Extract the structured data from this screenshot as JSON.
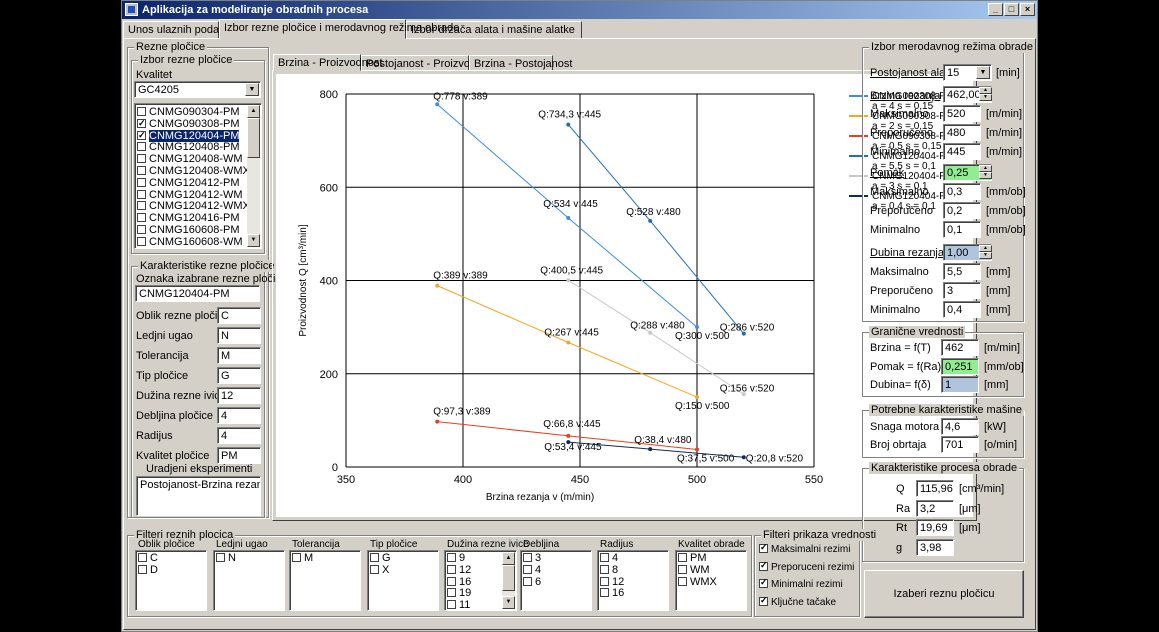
{
  "window": {
    "title": "Aplikacija za modeliranje obradnih procesa"
  },
  "main_tabs": [
    {
      "label": "Unos ulaznih podataka"
    },
    {
      "label": "Izbor rezne pločice i merodavnog režima obrade"
    },
    {
      "label": "Izbor držača alata i mašine alatke"
    }
  ],
  "rezne_plocice": {
    "group_label": "Rezne pločice",
    "izbor_label": "Izbor rezne pločice",
    "kvalitet_label": "Kvalitet",
    "kvalitet_value": "GC4205",
    "items": [
      {
        "label": "CNMG090304-PM",
        "checked": false,
        "selected": false
      },
      {
        "label": "CNMG090308-PM",
        "checked": true,
        "selected": false
      },
      {
        "label": "CNMG120404-PM",
        "checked": true,
        "selected": true
      },
      {
        "label": "CNMG120408-PM",
        "checked": false,
        "selected": false
      },
      {
        "label": "CNMG120408-WM",
        "checked": false,
        "selected": false
      },
      {
        "label": "CNMG120408-WMX",
        "checked": false,
        "selected": false
      },
      {
        "label": "CNMG120412-PM",
        "checked": false,
        "selected": false
      },
      {
        "label": "CNMG120412-WM",
        "checked": false,
        "selected": false
      },
      {
        "label": "CNMG120412-WMX",
        "checked": false,
        "selected": false
      },
      {
        "label": "CNMG120416-PM",
        "checked": false,
        "selected": false
      },
      {
        "label": "CNMG160608-PM",
        "checked": false,
        "selected": false
      },
      {
        "label": "CNMG160608-WM",
        "checked": false,
        "selected": false
      }
    ]
  },
  "karakteristike": {
    "group_label": "Karakteristike rezne pločice",
    "oznaka_label": "Oznaka izabrane rezne pločice",
    "oznaka_value": "CNMG120404-PM",
    "fields": [
      {
        "label": "Oblik rezne pločice",
        "value": "C"
      },
      {
        "label": "Ledjni ugao",
        "value": "N"
      },
      {
        "label": "Tolerancija",
        "value": "M"
      },
      {
        "label": "Tip pločice",
        "value": "G"
      },
      {
        "label": "Dužina rezne ivice",
        "value": "12"
      },
      {
        "label": "Debljina pločice",
        "value": "4"
      },
      {
        "label": "Radijus",
        "value": "4"
      },
      {
        "label": "Kvalitet  pločice",
        "value": "PM"
      }
    ],
    "eksperimenti_label": "Uradjeni eksperimenti",
    "eksperimenti_value": "Postojanost-Brzina rezanja"
  },
  "chart_tabs": [
    {
      "label": "Brzina - Proizvodnost"
    },
    {
      "label": "Postojanost - Proizvodnost"
    },
    {
      "label": "Brzina - Postojanost"
    }
  ],
  "chart_data": {
    "type": "line",
    "xlabel": "Brzina rezanja v (m/min)",
    "ylabel": "Proizvodnost Q [cm³/min]",
    "xlim": [
      350,
      550
    ],
    "ylim": [
      0,
      800
    ],
    "xticks": [
      350,
      400,
      450,
      500,
      550
    ],
    "yticks": [
      0,
      200,
      400,
      600,
      800
    ],
    "grid": true,
    "legend_position": "top-right",
    "series": [
      {
        "name": "CNMG090308-PM",
        "params": "a = 4   s = 0,15",
        "color": "#3b8de0",
        "points": [
          {
            "x": 389,
            "y": 778,
            "label": "Q:778 v:389"
          },
          {
            "x": 445,
            "y": 534,
            "label": "Q:534 v:445"
          },
          {
            "x": 500,
            "y": 300,
            "label": "Q:300 v:500"
          }
        ]
      },
      {
        "name": "CNMG090308-PM",
        "params": "a = 2   s = 0,15",
        "color": "#f5a623",
        "points": [
          {
            "x": 389,
            "y": 389,
            "label": "Q:389 v:389"
          },
          {
            "x": 445,
            "y": 267,
            "label": "Q:267 v:445"
          },
          {
            "x": 500,
            "y": 150,
            "label": "Q:150 v:500"
          }
        ]
      },
      {
        "name": "CNMG090308-PM",
        "params": "a = 0,5   s = 0,15",
        "color": "#e8401c",
        "points": [
          {
            "x": 389,
            "y": 97.3,
            "label": "Q:97,3 v:389"
          },
          {
            "x": 445,
            "y": 66.8,
            "label": "Q:66,8 v:445"
          },
          {
            "x": 500,
            "y": 37.5,
            "label": "Q:37,5 v:500"
          }
        ]
      },
      {
        "name": "CNMG120404-PM",
        "params": "a = 5,5   s = 0,1",
        "color": "#1f6fb0",
        "points": [
          {
            "x": 445,
            "y": 734.3,
            "label": "Q:734,3 v:445"
          },
          {
            "x": 480,
            "y": 528,
            "label": "Q:528 v:480"
          },
          {
            "x": 520,
            "y": 286,
            "label": "Q:286 v:520"
          }
        ]
      },
      {
        "name": "CNMG120404-PM",
        "params": "a = 3   s = 0,1",
        "color": "#c8c8c8",
        "points": [
          {
            "x": 445,
            "y": 400.5,
            "label": "Q:400,5 v:445"
          },
          {
            "x": 480,
            "y": 288,
            "label": "Q:288 v:480"
          },
          {
            "x": 520,
            "y": 156,
            "label": "Q:156 v:520"
          }
        ]
      },
      {
        "name": "CNMG120404-PM",
        "params": "a = 0,4   s = 0,1",
        "color": "#0d2a5a",
        "points": [
          {
            "x": 445,
            "y": 53.4,
            "label": "Q:53,4 v:445"
          },
          {
            "x": 480,
            "y": 38.4,
            "label": "Q:38,4 v:480"
          },
          {
            "x": 520,
            "y": 20.8,
            "label": "Q:20,8 v:520"
          }
        ]
      }
    ]
  },
  "rezim": {
    "group_label": "Izbor merodavnog režima obrade",
    "postojanost_label": "Postojanost alata",
    "postojanost_value": "15",
    "postojanost_unit": "[min]",
    "brzina_label": "Brzina rezanja",
    "brzina_value": "462,00",
    "brzina_rows": [
      {
        "label": "Maksimalno",
        "value": "520",
        "unit": "[m/min]"
      },
      {
        "label": "Preporučeno",
        "value": "480",
        "unit": "[m/min]"
      },
      {
        "label": "Minimalno",
        "value": "445",
        "unit": "[m/min]"
      }
    ],
    "pomak_label": "Pomak",
    "pomak_value": "0,25",
    "pomak_rows": [
      {
        "label": "Maksimalno",
        "value": "0,3",
        "unit": "[mm/ob]"
      },
      {
        "label": "Preporučeno",
        "value": "0,2",
        "unit": "[mm/ob]"
      },
      {
        "label": "Minimalno",
        "value": "0,1",
        "unit": "[mm/ob]"
      }
    ],
    "dubina_label": "Dubina rezanja",
    "dubina_value": "1,00",
    "dubina_rows": [
      {
        "label": "Maksimalno",
        "value": "5,5",
        "unit": "[mm]"
      },
      {
        "label": "Preporučeno",
        "value": "3",
        "unit": "[mm]"
      },
      {
        "label": "Minimalno",
        "value": "0,4",
        "unit": "[mm]"
      }
    ]
  },
  "granicne": {
    "group_label": "Granične vrednosti",
    "rows": [
      {
        "label": "Brzina  = f(T)",
        "value": "462",
        "unit": "[m/min]"
      },
      {
        "label": "Pomak  = f(Ra)",
        "value": "0,251",
        "unit": "[mm/ob]"
      },
      {
        "label": "Dubina= f(δ)",
        "value": "1",
        "unit": "[mm]"
      }
    ]
  },
  "masina": {
    "group_label": "Potrebne karakteristike mašine",
    "rows": [
      {
        "label": "Snaga motora",
        "value": "4,6",
        "unit": "[kW]"
      },
      {
        "label": "Broj obrtaja",
        "value": "701",
        "unit": "[o/min]"
      }
    ]
  },
  "proces": {
    "group_label": "Karakteristike procesa obrade",
    "rows": [
      {
        "label": "Q",
        "value": "115,96",
        "unit": "[cm³/min]"
      },
      {
        "label": "Ra",
        "value": "3,2",
        "unit": "[μm]"
      },
      {
        "label": "Rt",
        "value": "19,69",
        "unit": "[μm]"
      },
      {
        "label": "g",
        "value": "3,98",
        "unit": ""
      }
    ]
  },
  "select_button": "Izaberi reznu pločicu",
  "filteri": {
    "group_label": "Filteri reznih plocica",
    "columns": [
      {
        "title": "Oblik pločice",
        "items": [
          "C",
          "D"
        ]
      },
      {
        "title": "Ledjni ugao",
        "items": [
          "N"
        ]
      },
      {
        "title": "Tolerancija",
        "items": [
          "M"
        ]
      },
      {
        "title": "Tip pločice",
        "items": [
          "G",
          "X"
        ]
      },
      {
        "title": "Dužina rezne ivice",
        "items": [
          "9",
          "12",
          "16",
          "19",
          "11"
        ]
      },
      {
        "title": "Debljina",
        "items": [
          "3",
          "4",
          "6"
        ]
      },
      {
        "title": "Radijus",
        "items": [
          "4",
          "8",
          "12",
          "16"
        ]
      },
      {
        "title": "Kvalitet obrade",
        "items": [
          "PM",
          "WM",
          "WMX"
        ]
      }
    ]
  },
  "prikaz": {
    "group_label": "Filteri prikaza vrednosti",
    "items": [
      {
        "label": "Maksimalni rezimi",
        "checked": true
      },
      {
        "label": "Preporuceni rezimi",
        "checked": true
      },
      {
        "label": "Minimalni rezimi",
        "checked": true
      },
      {
        "label": "Ključne tačake",
        "checked": true
      }
    ]
  }
}
